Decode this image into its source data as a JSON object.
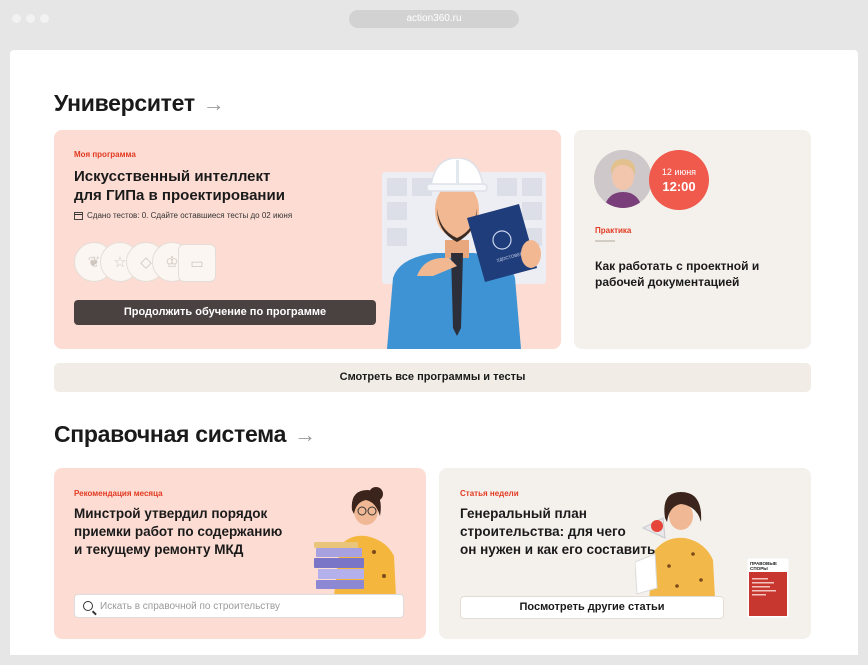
{
  "browser": {
    "url": "action360.ru"
  },
  "university": {
    "title": "Университет",
    "arrow": "→",
    "program_card": {
      "tag": "Моя программа",
      "title_line1": "Искусственный интеллект",
      "title_line2": "для ГИПа в проектировании",
      "tests_status": "Сдано тестов: 0. Сдайте оставшиеся тесты до 02 июня",
      "continue_button": "Продолжить обучение по программе",
      "certificate_text": "УДОСТОВЕРЕНИЕ"
    },
    "event_card": {
      "date": "12 июня",
      "time": "12:00",
      "tag": "Практика",
      "title_line1": "Как работать с проектной и",
      "title_line2": "рабочей документацией"
    },
    "all_programs_button": "Смотреть все программы и тесты"
  },
  "reference": {
    "title": "Справочная система",
    "arrow": "→",
    "month_card": {
      "tag": "Рекомендация месяца",
      "title_line1": "Минстрой утвердил порядок",
      "title_line2": "приемки работ по содержанию",
      "title_line3": "и текущему ремонту МКД",
      "search_placeholder": "Искать в справочной по строительству"
    },
    "week_card": {
      "tag": "Статья недели",
      "title_line1": "Генеральный план",
      "title_line2": "строительства: для чего",
      "title_line3": "он нужен и как его составить",
      "button": "Посмотреть другие статьи",
      "magazine_title_line1": "ПРАВОВЫЕ",
      "magazine_title_line2": "СПОРЫ"
    }
  },
  "colors": {
    "accent": "#e23a22",
    "pink_card": "#fcdcd3",
    "beige_card": "#f4f1ec",
    "date_circle": "#ef5a4c",
    "dark_button": "#4a4240"
  }
}
